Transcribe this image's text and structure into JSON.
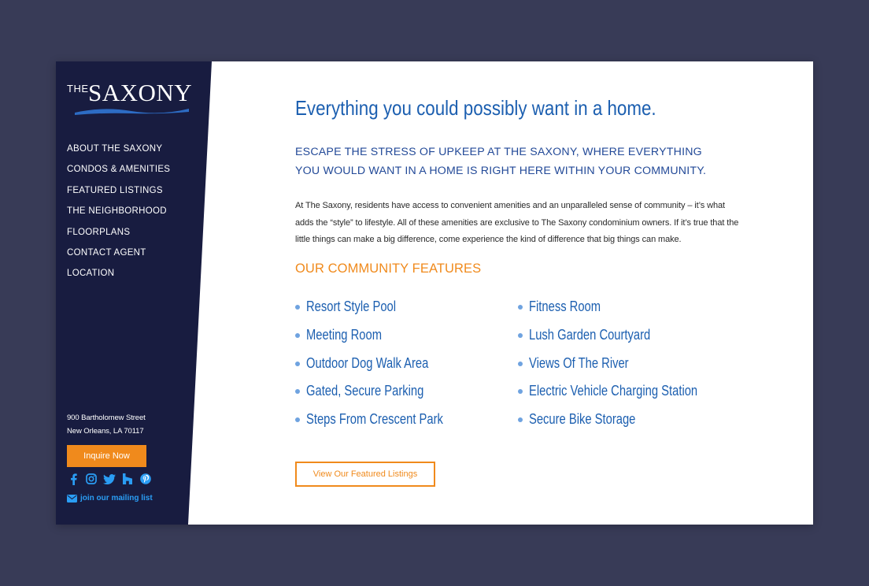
{
  "brand": {
    "the": "THE",
    "name": "SAXONY"
  },
  "nav": [
    "ABOUT THE SAXONY",
    "CONDOS & AMENITIES",
    "FEATURED LISTINGS",
    "THE NEIGHBORHOOD",
    "FLOORPLANS",
    "CONTACT AGENT",
    "LOCATION"
  ],
  "sidebar": {
    "address_line1": "900 Bartholomew Street",
    "address_line2": "New Orleans, LA 70117",
    "inquire_label": "Inquire Now",
    "social_icons": [
      "facebook-icon",
      "instagram-icon",
      "twitter-icon",
      "houzz-icon",
      "pinterest-icon"
    ],
    "mailing_label": "join our mailing list"
  },
  "main": {
    "title": "Everything you could possibly want in a home.",
    "subtitle": "ESCAPE THE STRESS OF UPKEEP AT THE SAXONY, WHERE EVERYTHING YOU WOULD WANT IN A HOME IS RIGHT HERE WITHIN YOUR COMMUNITY.",
    "body": "At The Saxony, residents have access to convenient amenities and an unparalleled sense of community – it’s what adds the “style” to lifestyle. All of these amenities are exclusive to The Saxony condominium owners. If it’s true that the little things can make a big difference, come experience the kind of difference that big things can make.",
    "features_heading": "OUR COMMUNITY FEATURES",
    "features_left": [
      "Resort Style Pool",
      "Meeting Room",
      "Outdoor Dog Walk Area",
      "Gated, Secure Parking",
      "Steps From Crescent Park"
    ],
    "features_right": [
      "Fitness Room",
      "Lush Garden Courtyard",
      "Views Of The River",
      "Electric Vehicle Charging Station",
      "Secure Bike Storage"
    ],
    "listings_button": "View Our Featured Listings"
  },
  "colors": {
    "page_bg": "#383b57",
    "sidebar_bg": "#181c40",
    "accent_orange": "#f08a1c",
    "title_blue": "#1c5fb0",
    "social_blue": "#2a9df4"
  }
}
